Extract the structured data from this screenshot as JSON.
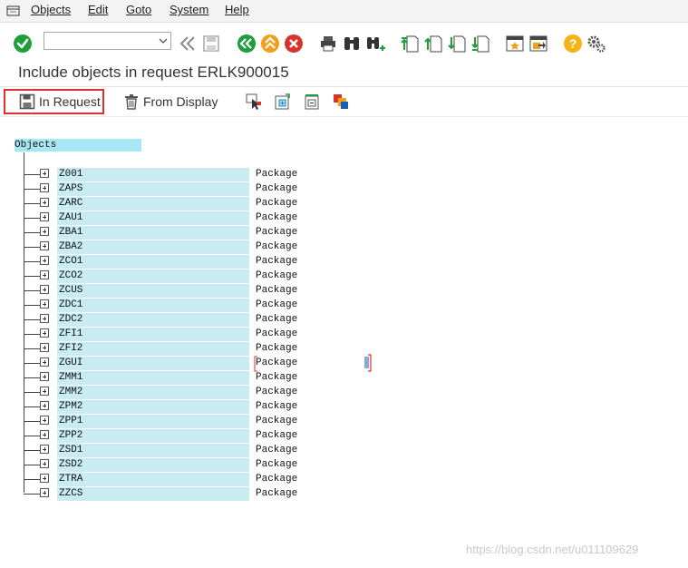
{
  "menu": {
    "items": [
      {
        "label": "Objects"
      },
      {
        "label": "Edit"
      },
      {
        "label": "Goto"
      },
      {
        "label": "System"
      },
      {
        "label": "Help"
      }
    ]
  },
  "toolbar": {
    "command_value": "",
    "icons": [
      "enter-icon",
      "back-double-icon",
      "save-icon",
      "back-icon",
      "exit-icon",
      "cancel-icon",
      "print-icon",
      "find-icon",
      "find-next-icon",
      "first-page-icon",
      "previous-page-icon",
      "next-page-icon",
      "last-page-icon",
      "new-session-icon",
      "shortcut-icon",
      "help-icon",
      "customize-layout-icon"
    ]
  },
  "page": {
    "title": "Include objects in request ERLK900015"
  },
  "app_toolbar": {
    "in_request_label": "In Request",
    "from_display_label": "From Display"
  },
  "tree": {
    "header": "Objects",
    "rows": [
      {
        "name": "Z001",
        "type": "Package"
      },
      {
        "name": "ZAPS",
        "type": "Package"
      },
      {
        "name": "ZARC",
        "type": "Package"
      },
      {
        "name": "ZAU1",
        "type": "Package"
      },
      {
        "name": "ZBA1",
        "type": "Package"
      },
      {
        "name": "ZBA2",
        "type": "Package"
      },
      {
        "name": "ZCO1",
        "type": "Package"
      },
      {
        "name": "ZCO2",
        "type": "Package"
      },
      {
        "name": "ZCUS",
        "type": "Package"
      },
      {
        "name": "ZDC1",
        "type": "Package"
      },
      {
        "name": "ZDC2",
        "type": "Package"
      },
      {
        "name": "ZFI1",
        "type": "Package"
      },
      {
        "name": "ZFI2",
        "type": "Package"
      },
      {
        "name": "ZGUI",
        "type": "Package"
      },
      {
        "name": "ZMM1",
        "type": "Package"
      },
      {
        "name": "ZMM2",
        "type": "Package"
      },
      {
        "name": "ZPM2",
        "type": "Package"
      },
      {
        "name": "ZPP1",
        "type": "Package"
      },
      {
        "name": "ZPP2",
        "type": "Package"
      },
      {
        "name": "ZSD1",
        "type": "Package"
      },
      {
        "name": "ZSD2",
        "type": "Package"
      },
      {
        "name": "ZTRA",
        "type": "Package"
      },
      {
        "name": "ZZCS",
        "type": "Package"
      }
    ]
  },
  "watermark": "https://blog.csdn.net/u011109629",
  "colors": {
    "highlight_border": "#e2312c",
    "tree_header_bg": "#a8e6f4",
    "tree_item_bg": "#c8ecf2",
    "enter_green": "#1f9e3c",
    "nav_orange": "#f0a01a",
    "cancel_red": "#d8342c",
    "help_yellow": "#f5b31a"
  }
}
